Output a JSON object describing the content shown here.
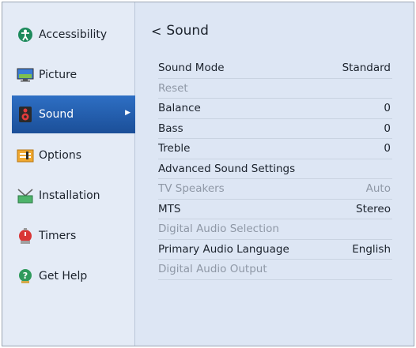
{
  "sidebar": {
    "items": [
      {
        "label": "Accessibility",
        "icon": "accessibility-icon"
      },
      {
        "label": "Picture",
        "icon": "picture-icon"
      },
      {
        "label": "Sound",
        "icon": "speaker-icon",
        "active": true
      },
      {
        "label": "Options",
        "icon": "options-icon"
      },
      {
        "label": "Installation",
        "icon": "antenna-icon"
      },
      {
        "label": "Timers",
        "icon": "timer-icon"
      },
      {
        "label": "Get Help",
        "icon": "help-icon"
      }
    ]
  },
  "main": {
    "back_arrow": "<",
    "title": "Sound",
    "rows": [
      {
        "label": "Sound Mode",
        "value": "Standard"
      },
      {
        "label": "Reset",
        "value": ""
      },
      {
        "label": "Balance",
        "value": "0"
      },
      {
        "label": "Bass",
        "value": "0"
      },
      {
        "label": "Treble",
        "value": "0"
      },
      {
        "label": "Advanced Sound Settings",
        "value": ""
      },
      {
        "label": "TV Speakers",
        "value": "Auto"
      },
      {
        "label": "MTS",
        "value": "Stereo"
      },
      {
        "label": "Digital Audio Selection",
        "value": ""
      },
      {
        "label": "Primary Audio Language",
        "value": "English"
      },
      {
        "label": "Digital Audio Output",
        "value": ""
      }
    ]
  },
  "colors": {
    "active_item": "#2e6fc4",
    "panel_bg": "#dde6f4",
    "disabled_text": "#8f98a6"
  }
}
